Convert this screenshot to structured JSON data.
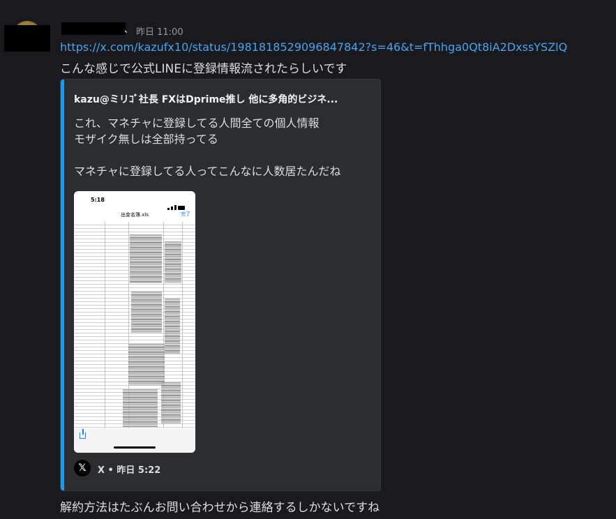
{
  "message": {
    "author_tail": "、",
    "timestamp": "昨日 11:00",
    "link": "https://x.com/kazufx10/status/1981818529096847842?s=46&t=fThhga0Qt8iA2DxssYSZlQ",
    "text_line1": "こんな感じで公式LINEに登録情報流されたらしいです",
    "text_line2": "解約方法はたぶんお問い合わせから連絡するしかないですね"
  },
  "embed": {
    "accent_color": "#1d9bf0",
    "author": "kazu@ミリｺﾞ社長 FXはDprime推し 他に多角的ビジネ...",
    "desc_lines": [
      "これ、マネチャに登録してる人間全ての個人情報",
      "モザイク無しは全部持ってる",
      "",
      "マネチャに登録してる人ってこんなに人数居たんだね"
    ],
    "image": {
      "time": "5:18",
      "filename": "出金名簿.xls",
      "done": "完了"
    },
    "footer": {
      "icon": "x-logo-icon",
      "text": "X • 昨日 5:22"
    }
  }
}
